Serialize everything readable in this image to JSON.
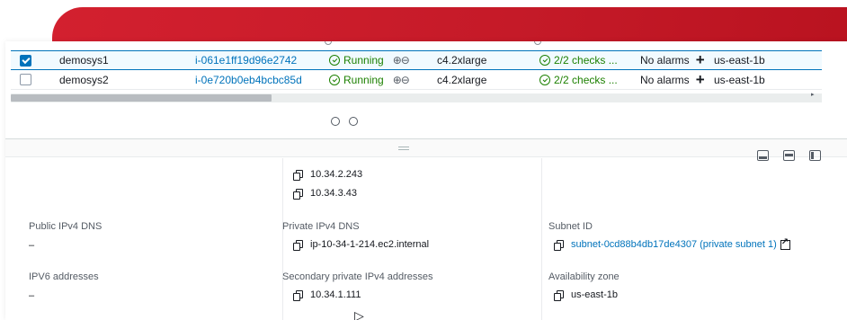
{
  "instances": [
    {
      "selected": true,
      "name": "demosys1",
      "instance_id": "i-061e1ff19d96e2742",
      "state": "Running",
      "type": "c4.2xlarge",
      "status_check": "2/2 checks ...",
      "alarm": "No alarms",
      "az": "us-east-1b"
    },
    {
      "selected": false,
      "name": "demosys2",
      "instance_id": "i-0e720b0eb4bcbc85d",
      "state": "Running",
      "type": "c4.2xlarge",
      "status_check": "2/2 checks ...",
      "alarm": "No alarms",
      "az": "us-east-1b"
    }
  ],
  "details": {
    "private_ips": [
      "10.34.2.243",
      "10.34.3.43"
    ],
    "public_dns_label": "Public IPv4 DNS",
    "public_dns_value": "–",
    "ipv6_label": "IPV6 addresses",
    "ipv6_value": "–",
    "private_dns_label": "Private IPv4 DNS",
    "private_dns_value": "ip-10-34-1-214.ec2.internal",
    "secondary_ip_label": "Secondary private IPv4 addresses",
    "secondary_ip_value": "10.34.1.111",
    "subnet_label": "Subnet ID",
    "subnet_value": "subnet-0cd88b4db17de4307 (private subnet 1)",
    "az_label": "Availability zone",
    "az_value": "us-east-1b"
  },
  "colors": {
    "banner": "#d3202f",
    "link": "#0073bb",
    "success": "#1d8102"
  },
  "icons": [
    "checkbox",
    "status-check-icon",
    "zoom-icons",
    "plus-icon",
    "copy-icon",
    "external-link-icon",
    "pagination-dot",
    "panel-layout-icon",
    "mouse-cursor-icon"
  ]
}
